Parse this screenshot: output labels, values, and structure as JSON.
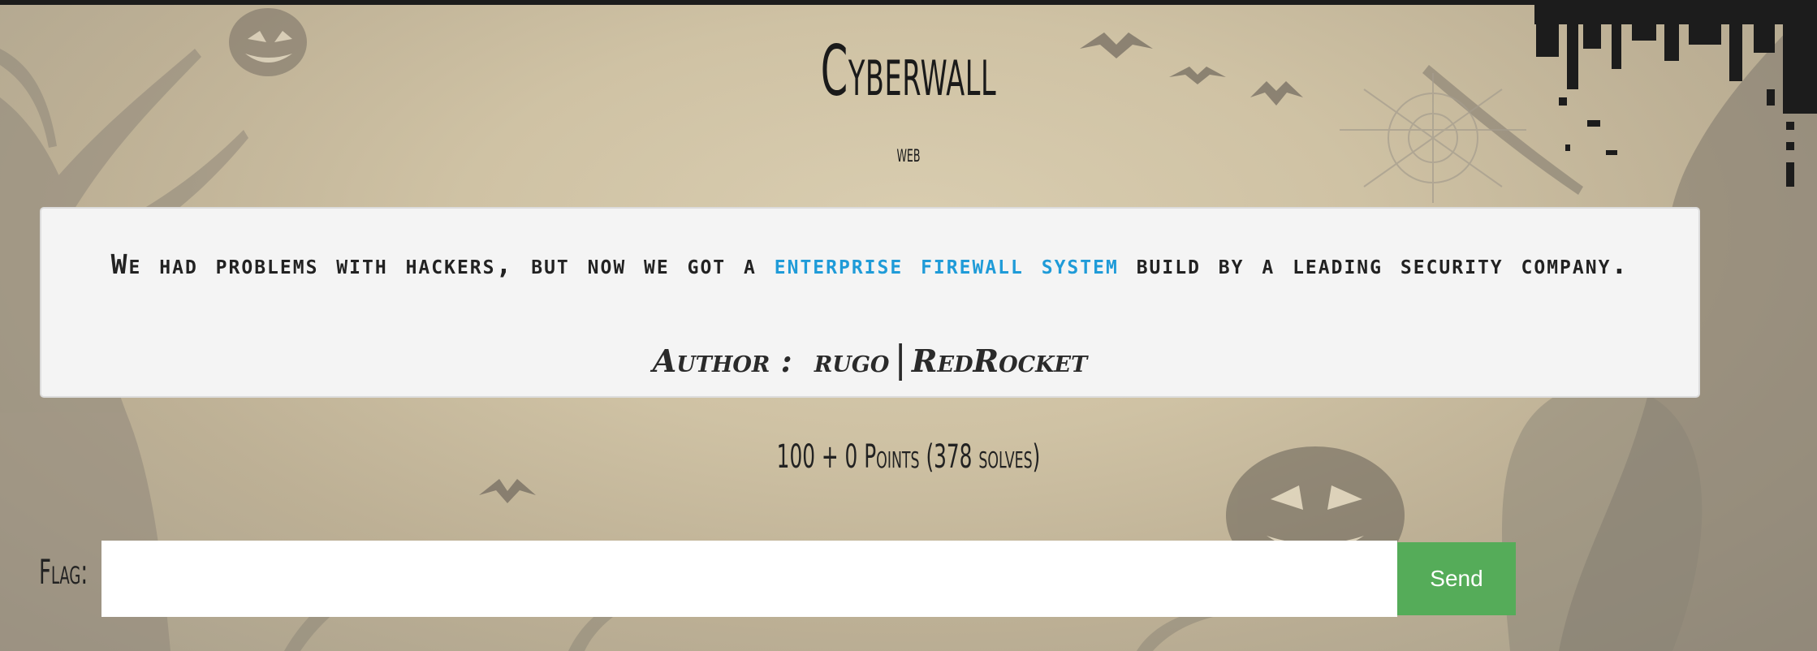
{
  "header": {
    "title": "Cyberwall",
    "category": "web"
  },
  "challenge": {
    "description_before": "We had problems with hackers, but now we got a ",
    "description_link": "enterprise firewall system",
    "description_after": " build by a leading security company.",
    "author_label": "Author :",
    "author_name": "rugo",
    "author_separator": "|",
    "author_team": "RedRocket",
    "points": "100 + 0 Points (378 solves)"
  },
  "flag_form": {
    "label": "Flag:",
    "input_value": "",
    "input_placeholder": "",
    "send_label": "Send"
  },
  "colors": {
    "accent_link": "#1f9bd8",
    "send_button": "#55ac59",
    "box_background": "#f4f4f4"
  },
  "icons": {
    "background": "halloween-scene-illustration"
  }
}
